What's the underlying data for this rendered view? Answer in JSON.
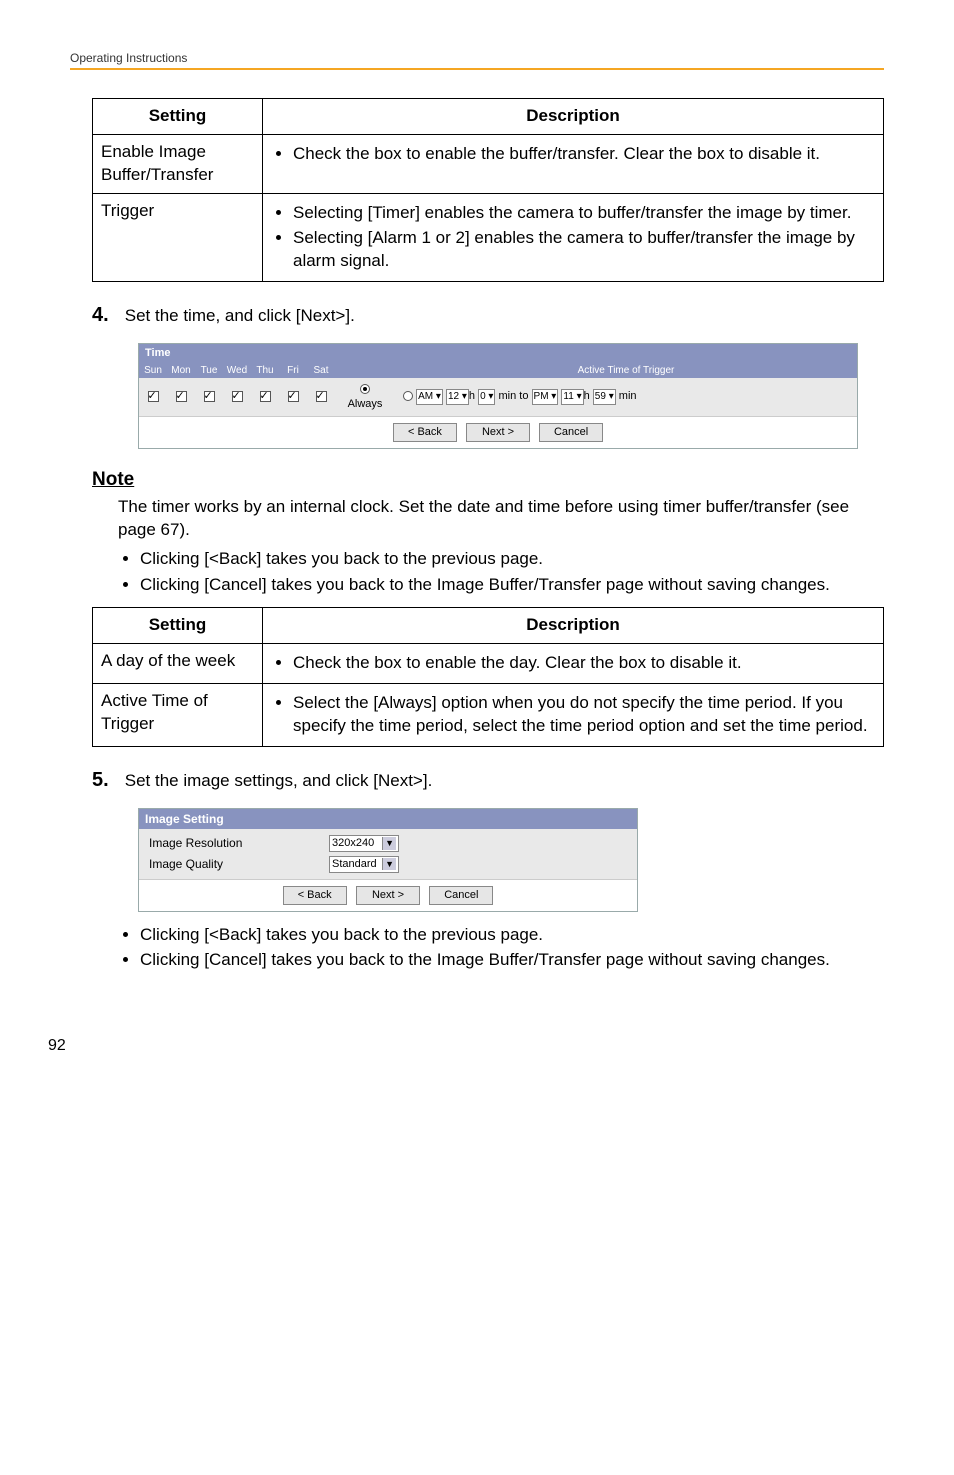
{
  "header": {
    "title": "Operating Instructions"
  },
  "table1": {
    "col_setting": "Setting",
    "col_desc": "Description",
    "r1_setting": "Enable Image Buffer/Transfer",
    "r1_b1": "Check the box to enable the buffer/transfer. Clear the box to disable it.",
    "r2_setting": "Trigger",
    "r2_b1": "Selecting [Timer] enables the camera to buffer/transfer the image by timer.",
    "r2_b2": "Selecting [Alarm 1 or 2] enables the camera to buffer/transfer the image by alarm signal."
  },
  "step4": {
    "num": "4.",
    "text": "Set the time, and click [Next>]."
  },
  "time_panel": {
    "title": "Time",
    "days": [
      "Sun",
      "Mon",
      "Tue",
      "Wed",
      "Thu",
      "Fri",
      "Sat"
    ],
    "active_label": "Active Time of Trigger",
    "always": "Always",
    "ampm1": "AM",
    "h1": "12",
    "m1": "0",
    "min_to": "min to",
    "ampm2": "PM",
    "h2": "11",
    "m2": "59",
    "min_end": "min",
    "h_lbl": "h",
    "btn_back": "< Back",
    "btn_next": "Next >",
    "btn_cancel": "Cancel"
  },
  "note": {
    "head": "Note",
    "para": "The timer works by an internal clock. Set the date and time before using timer buffer/transfer (see page 67).",
    "b1": "Clicking [<Back] takes you back to the previous page.",
    "b2": "Clicking [Cancel] takes you back to the Image Buffer/Transfer page without saving changes."
  },
  "table2": {
    "col_setting": "Setting",
    "col_desc": "Description",
    "r1_setting": "A day of the week",
    "r1_b1": "Check the box to enable the day. Clear the box to disable it.",
    "r2_setting": "Active Time of Trigger",
    "r2_b1": "Select the [Always] option when you do not specify the time period. If you specify the time period, select the time period option and set the time period."
  },
  "step5": {
    "num": "5.",
    "text": "Set the image settings, and click [Next>]."
  },
  "img_setting": {
    "title": "Image Setting",
    "r1_lbl": "Image Resolution",
    "r1_val": "320x240",
    "r2_lbl": "Image Quality",
    "r2_val": "Standard",
    "btn_back": "< Back",
    "btn_next": "Next >",
    "btn_cancel": "Cancel"
  },
  "after_img": {
    "b1": "Clicking [<Back] takes you back to the previous page.",
    "b2": "Clicking [Cancel] takes you back to the Image Buffer/Transfer page without saving changes."
  },
  "page_number": "92"
}
